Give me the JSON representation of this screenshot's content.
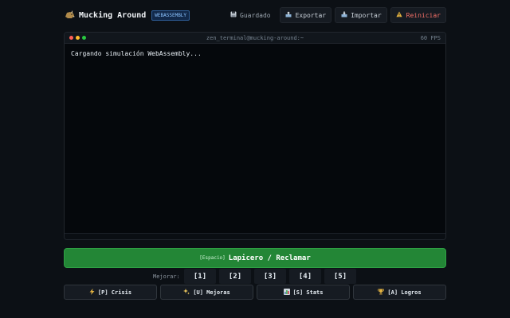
{
  "header": {
    "title": "Mucking Around",
    "badge": "WEBASSEMBLY",
    "brand_icon": "boar-icon",
    "actions": {
      "saved": {
        "label": "Guardado",
        "icon": "floppy-disk-icon"
      },
      "export": {
        "label": "Exportar",
        "icon": "export-tray-icon"
      },
      "import": {
        "label": "Importar",
        "icon": "import-tray-icon"
      },
      "reset": {
        "label": "Reiniciar",
        "icon": "warning-icon"
      }
    }
  },
  "terminal": {
    "title": "zen_terminal@mucking-around:~",
    "fps": "60 FPS",
    "output": "Cargando simulación WebAssembly..."
  },
  "main_action": {
    "key": "[Espacio]",
    "label": "Lapicero / Reclamar"
  },
  "upgrade": {
    "label": "Mejorar:",
    "levels": [
      "[1]",
      "[2]",
      "[3]",
      "[4]",
      "[5]"
    ]
  },
  "nav": {
    "crisis": {
      "label": "[P] Crisis",
      "icon": "lightning-icon"
    },
    "upgrades": {
      "label": "[U] Mejoras",
      "icon": "sparkles-icon"
    },
    "stats": {
      "label": "[S] Stats",
      "icon": "bar-chart-icon"
    },
    "achievements": {
      "label": "[A] Logros",
      "icon": "trophy-icon"
    }
  },
  "colors": {
    "background": "#0c1015",
    "accent_green": "#238636",
    "danger": "#f47067",
    "badge_blue": "#8cc4ff"
  }
}
